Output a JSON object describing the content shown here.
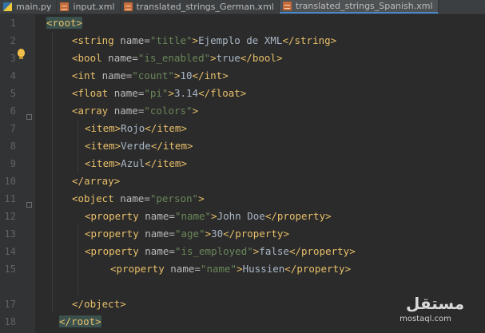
{
  "tabs": [
    {
      "label": "main.py",
      "icon": "python-file-icon",
      "active": false
    },
    {
      "label": "input.xml",
      "icon": "xml-file-icon",
      "active": false
    },
    {
      "label": "translated_strings_German.xml",
      "icon": "xml-file-icon",
      "active": false
    },
    {
      "label": "translated_strings_Spanish.xml",
      "icon": "xml-file-icon",
      "active": true
    }
  ],
  "line_numbers": [
    "1",
    "2",
    "3",
    "4",
    "5",
    "6",
    "7",
    "8",
    "9",
    "10",
    "11",
    "12",
    "13",
    "14",
    "15",
    "",
    "17",
    "18"
  ],
  "code": {
    "l1": {
      "t1": "root"
    },
    "l2": {
      "t1": "string",
      "a1": "name",
      "v1": "\"title\"",
      "txt": "Ejemplo de XML",
      "t2": "string"
    },
    "l3": {
      "t1": "bool",
      "a1": "name",
      "v1": "\"is_enabled\"",
      "txt": "true",
      "t2": "bool"
    },
    "l4": {
      "t1": "int",
      "a1": "name",
      "v1": "\"count\"",
      "txt": "10",
      "t2": "int"
    },
    "l5": {
      "t1": "float",
      "a1": "name",
      "v1": "\"pi\"",
      "txt": "3.14",
      "t2": "float"
    },
    "l6": {
      "t1": "array",
      "a1": "name",
      "v1": "\"colors\""
    },
    "l7": {
      "t1": "item",
      "txt": "Rojo",
      "t2": "item"
    },
    "l8": {
      "t1": "item",
      "txt": "Verde",
      "t2": "item"
    },
    "l9": {
      "t1": "item",
      "txt": "Azul",
      "t2": "item"
    },
    "l10": {
      "t2": "array"
    },
    "l11": {
      "t1": "object",
      "a1": "name",
      "v1": "\"person\""
    },
    "l12": {
      "t1": "property",
      "a1": "name",
      "v1": "\"name\"",
      "txt": "John Doe",
      "t2": "property"
    },
    "l13": {
      "t1": "property",
      "a1": "name",
      "v1": "\"age\"",
      "txt": "30",
      "t2": "property"
    },
    "l14": {
      "t1": "property",
      "a1": "name",
      "v1": "\"is_employed\"",
      "txt": "false",
      "t2": "property"
    },
    "l15": {
      "t1": "property",
      "a1": "name",
      "v1": "\"name\"",
      "txt": "Hussien",
      "t2": "property"
    },
    "l17": {
      "t2": "object"
    },
    "l18": {
      "t2": "root"
    }
  },
  "watermark": {
    "arabic": "مستقل",
    "latin": "mostaql.com"
  },
  "colors": {
    "background": "#2b2b2b",
    "tag": "#e8bf6a",
    "attribute": "#bababa",
    "value": "#6a8759",
    "text": "#a9b7c6",
    "active_tab_underline": "#4a88c7"
  }
}
